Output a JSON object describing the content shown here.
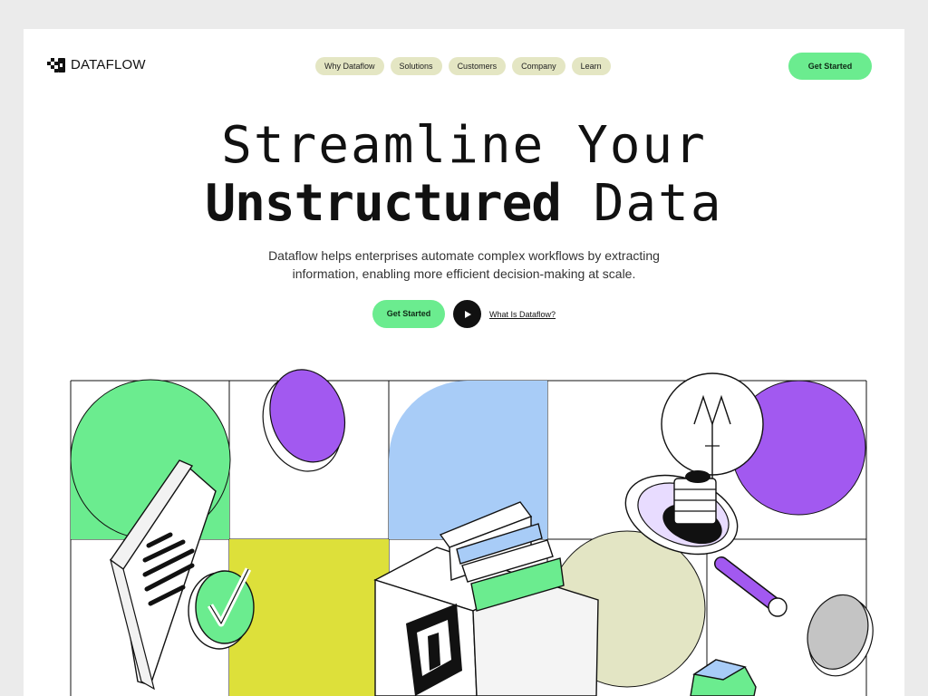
{
  "brand": {
    "name": "DATAFLOW",
    "logo_icon": "pixel-arrow-icon"
  },
  "nav": {
    "items": [
      {
        "label": "Why Dataflow"
      },
      {
        "label": "Solutions"
      },
      {
        "label": "Customers"
      },
      {
        "label": "Company"
      },
      {
        "label": "Learn"
      }
    ]
  },
  "header": {
    "cta_label": "Get Started"
  },
  "hero": {
    "line1": "Streamline Your",
    "line2_bold": "Unstructured",
    "line2_rest": "Data",
    "subtitle": "Dataflow helps enterprises automate complex workflows by extracting information, enabling more efficient decision-making at scale.",
    "primary_cta": "Get Started",
    "play_icon": "play-icon",
    "secondary_link": "What Is Dataflow?"
  },
  "colors": {
    "accent_green": "#6bec8f",
    "nav_pill": "#e4e6c3",
    "purple": "#a259f0",
    "blue": "#a8ccf7",
    "yellow": "#dde03a",
    "beige": "#e3e5c4",
    "gray": "#c4c4c4"
  }
}
